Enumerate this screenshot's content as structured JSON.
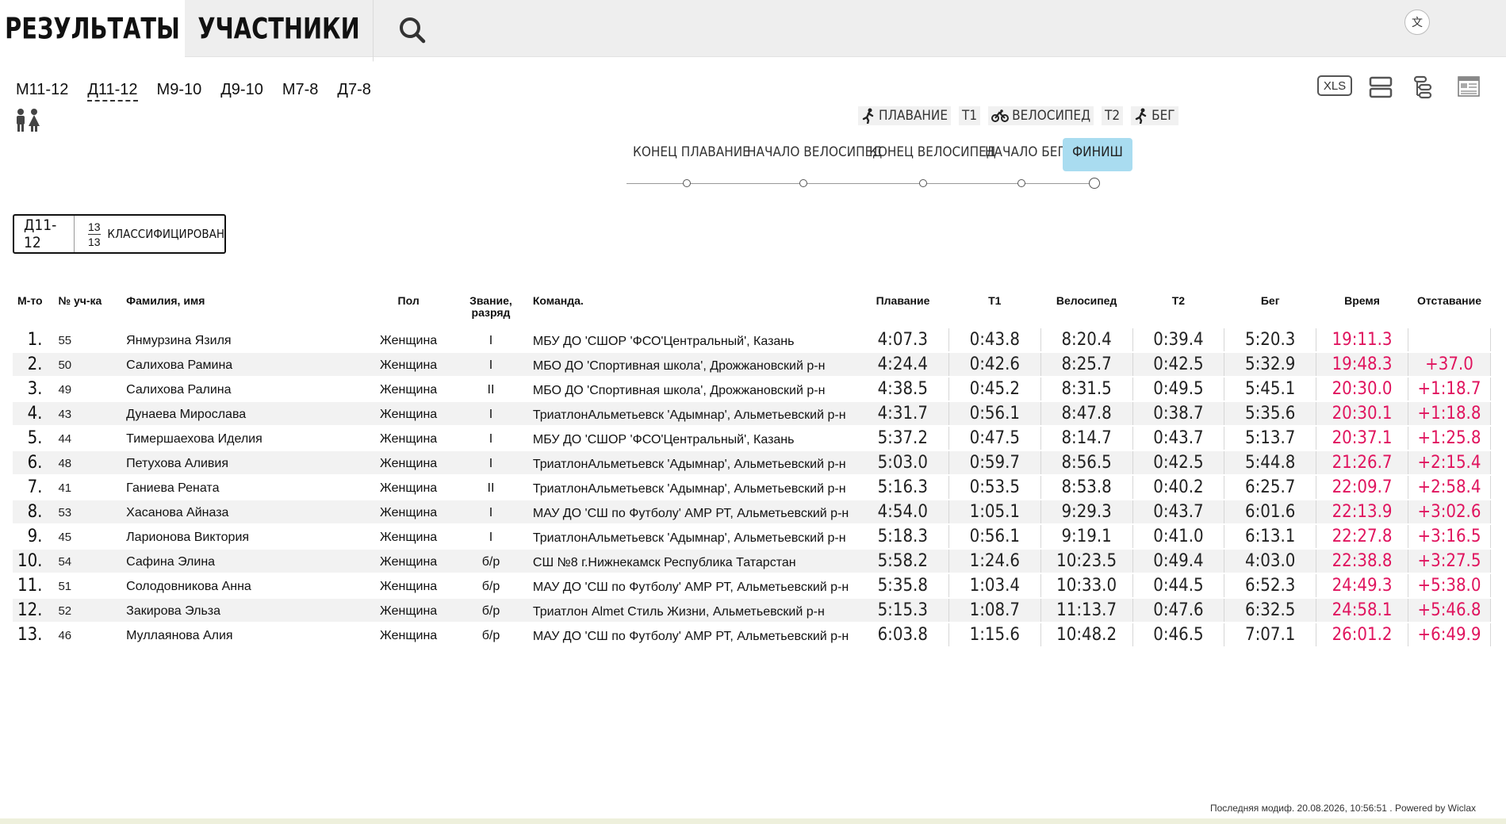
{
  "tabs": {
    "results": "РЕЗУЛЬТАТЫ",
    "participants": "УЧАСТНИКИ"
  },
  "lang_icon": "文",
  "groups": [
    "М11-12",
    "Д11-12",
    "М9-10",
    "Д9-10",
    "М7-8",
    "Д7-8"
  ],
  "active_group": "Д11-12",
  "tools": {
    "xls": "XLS"
  },
  "disciplines": {
    "swim": "ПЛАВАНИЕ",
    "t1": "T1",
    "bike": "ВЕЛОСИПЕД",
    "t2": "T2",
    "run": "БЕГ"
  },
  "checkpoints": [
    "КОНЕЦ ПЛАВАНИЕ",
    "НАЧАЛО ВЕЛОСИПЕД",
    "КОНЕЦ ВЕЛОСИПЕД",
    "НАЧАЛО БЕГ",
    "ФИНИШ"
  ],
  "badge": {
    "name": "Д11-12",
    "top": "13",
    "bottom": "13",
    "label": "КЛАССИФИЦИРОВАН"
  },
  "columns": {
    "place": "М-то",
    "bib": "№ уч-ка",
    "name": "Фамилия, имя",
    "gender": "Пол",
    "rank": "Звание, разряд",
    "team": "Команда.",
    "swim": "Плавание",
    "t1": "T1",
    "bike": "Велосипед",
    "t2": "T2",
    "run": "Бег",
    "time": "Время",
    "gap": "Отставание"
  },
  "rows": [
    {
      "place": "1.",
      "bib": "55",
      "name": "Янмурзина Язиля",
      "gender": "Женщина",
      "rank": "I",
      "team": "МБУ ДО 'СШОР 'ФСО'Центральный', Казань",
      "swim": "4:07.3",
      "t1": "0:43.8",
      "bike": "8:20.4",
      "t2": "0:39.4",
      "run": "5:20.3",
      "time": "19:11.3",
      "gap": ""
    },
    {
      "place": "2.",
      "bib": "50",
      "name": "Салихова Рамина",
      "gender": "Женщина",
      "rank": "I",
      "team": "МБО ДО 'Спортивная школа', Дрожжановский р-н",
      "swim": "4:24.4",
      "t1": "0:42.6",
      "bike": "8:25.7",
      "t2": "0:42.5",
      "run": "5:32.9",
      "time": "19:48.3",
      "gap": "+37.0"
    },
    {
      "place": "3.",
      "bib": "49",
      "name": "Салихова Ралина",
      "gender": "Женщина",
      "rank": "II",
      "team": "МБО ДО 'Спортивная школа', Дрожжановский р-н",
      "swim": "4:38.5",
      "t1": "0:45.2",
      "bike": "8:31.5",
      "t2": "0:49.5",
      "run": "5:45.1",
      "time": "20:30.0",
      "gap": "+1:18.7"
    },
    {
      "place": "4.",
      "bib": "43",
      "name": "Дунаева Мирослава",
      "gender": "Женщина",
      "rank": "I",
      "team": "ТриатлонАльметьевск 'Адымнар', Альметьевский р-н",
      "swim": "4:31.7",
      "t1": "0:56.1",
      "bike": "8:47.8",
      "t2": "0:38.7",
      "run": "5:35.6",
      "time": "20:30.1",
      "gap": "+1:18.8"
    },
    {
      "place": "5.",
      "bib": "44",
      "name": "Тимершаехова Иделия",
      "gender": "Женщина",
      "rank": "I",
      "team": "МБУ ДО 'СШОР 'ФСО'Центральный', Казань",
      "swim": "5:37.2",
      "t1": "0:47.5",
      "bike": "8:14.7",
      "t2": "0:43.7",
      "run": "5:13.7",
      "time": "20:37.1",
      "gap": "+1:25.8"
    },
    {
      "place": "6.",
      "bib": "48",
      "name": "Петухова Аливия",
      "gender": "Женщина",
      "rank": "I",
      "team": "ТриатлонАльметьевск 'Адымнар', Альметьевский р-н",
      "swim": "5:03.0",
      "t1": "0:59.7",
      "bike": "8:56.5",
      "t2": "0:42.5",
      "run": "5:44.8",
      "time": "21:26.7",
      "gap": "+2:15.4"
    },
    {
      "place": "7.",
      "bib": "41",
      "name": "Ганиева Рената",
      "gender": "Женщина",
      "rank": "II",
      "team": "ТриатлонАльметьевск 'Адымнар', Альметьевский р-н",
      "swim": "5:16.3",
      "t1": "0:53.5",
      "bike": "8:53.8",
      "t2": "0:40.2",
      "run": "6:25.7",
      "time": "22:09.7",
      "gap": "+2:58.4"
    },
    {
      "place": "8.",
      "bib": "53",
      "name": "Хасанова Айназа",
      "gender": "Женщина",
      "rank": "I",
      "team": "МАУ ДО 'СШ по Футболу' АМР РТ, Альметьевский р-н",
      "swim": "4:54.0",
      "t1": "1:05.1",
      "bike": "9:29.3",
      "t2": "0:43.7",
      "run": "6:01.6",
      "time": "22:13.9",
      "gap": "+3:02.6"
    },
    {
      "place": "9.",
      "bib": "45",
      "name": "Ларионова Виктория",
      "gender": "Женщина",
      "rank": "I",
      "team": "ТриатлонАльметьевск 'Адымнар', Альметьевский р-н",
      "swim": "5:18.3",
      "t1": "0:56.1",
      "bike": "9:19.1",
      "t2": "0:41.0",
      "run": "6:13.1",
      "time": "22:27.8",
      "gap": "+3:16.5"
    },
    {
      "place": "10.",
      "bib": "54",
      "name": "Сафина Элина",
      "gender": "Женщина",
      "rank": "б/р",
      "team": "СШ №8 г.Нижнекамск Республика Татарстан",
      "swim": "5:58.2",
      "t1": "1:24.6",
      "bike": "10:23.5",
      "t2": "0:49.4",
      "run": "4:03.0",
      "time": "22:38.8",
      "gap": "+3:27.5"
    },
    {
      "place": "11.",
      "bib": "51",
      "name": "Солодовникова Анна",
      "gender": "Женщина",
      "rank": "б/р",
      "team": "МАУ ДО 'СШ по Футболу' АМР РТ, Альметьевский р-н",
      "swim": "5:35.8",
      "t1": "1:03.4",
      "bike": "10:33.0",
      "t2": "0:44.5",
      "run": "6:52.3",
      "time": "24:49.3",
      "gap": "+5:38.0"
    },
    {
      "place": "12.",
      "bib": "52",
      "name": "Закирова Эльза",
      "gender": "Женщина",
      "rank": "б/р",
      "team": "Триатлон Almet Стиль Жизни, Альметьевский р-н",
      "swim": "5:15.3",
      "t1": "1:08.7",
      "bike": "11:13.7",
      "t2": "0:47.6",
      "run": "6:32.5",
      "time": "24:58.1",
      "gap": "+5:46.8"
    },
    {
      "place": "13.",
      "bib": "46",
      "name": "Муллаянова Алия",
      "gender": "Женщина",
      "rank": "б/р",
      "team": "МАУ ДО 'СШ по Футболу' АМР РТ, Альметьевский р-н",
      "swim": "6:03.8",
      "t1": "1:15.6",
      "bike": "10:48.2",
      "t2": "0:46.5",
      "run": "7:07.1",
      "time": "26:01.2",
      "gap": "+6:49.9"
    }
  ],
  "footer": "Последняя модиф. 20.08.2026, 10:56:51 . Powered by Wiclax",
  "colors": {
    "accent_time": "#e0145e",
    "active_checkpoint": "#a9dcf0",
    "topbar": "#eeeeee"
  }
}
